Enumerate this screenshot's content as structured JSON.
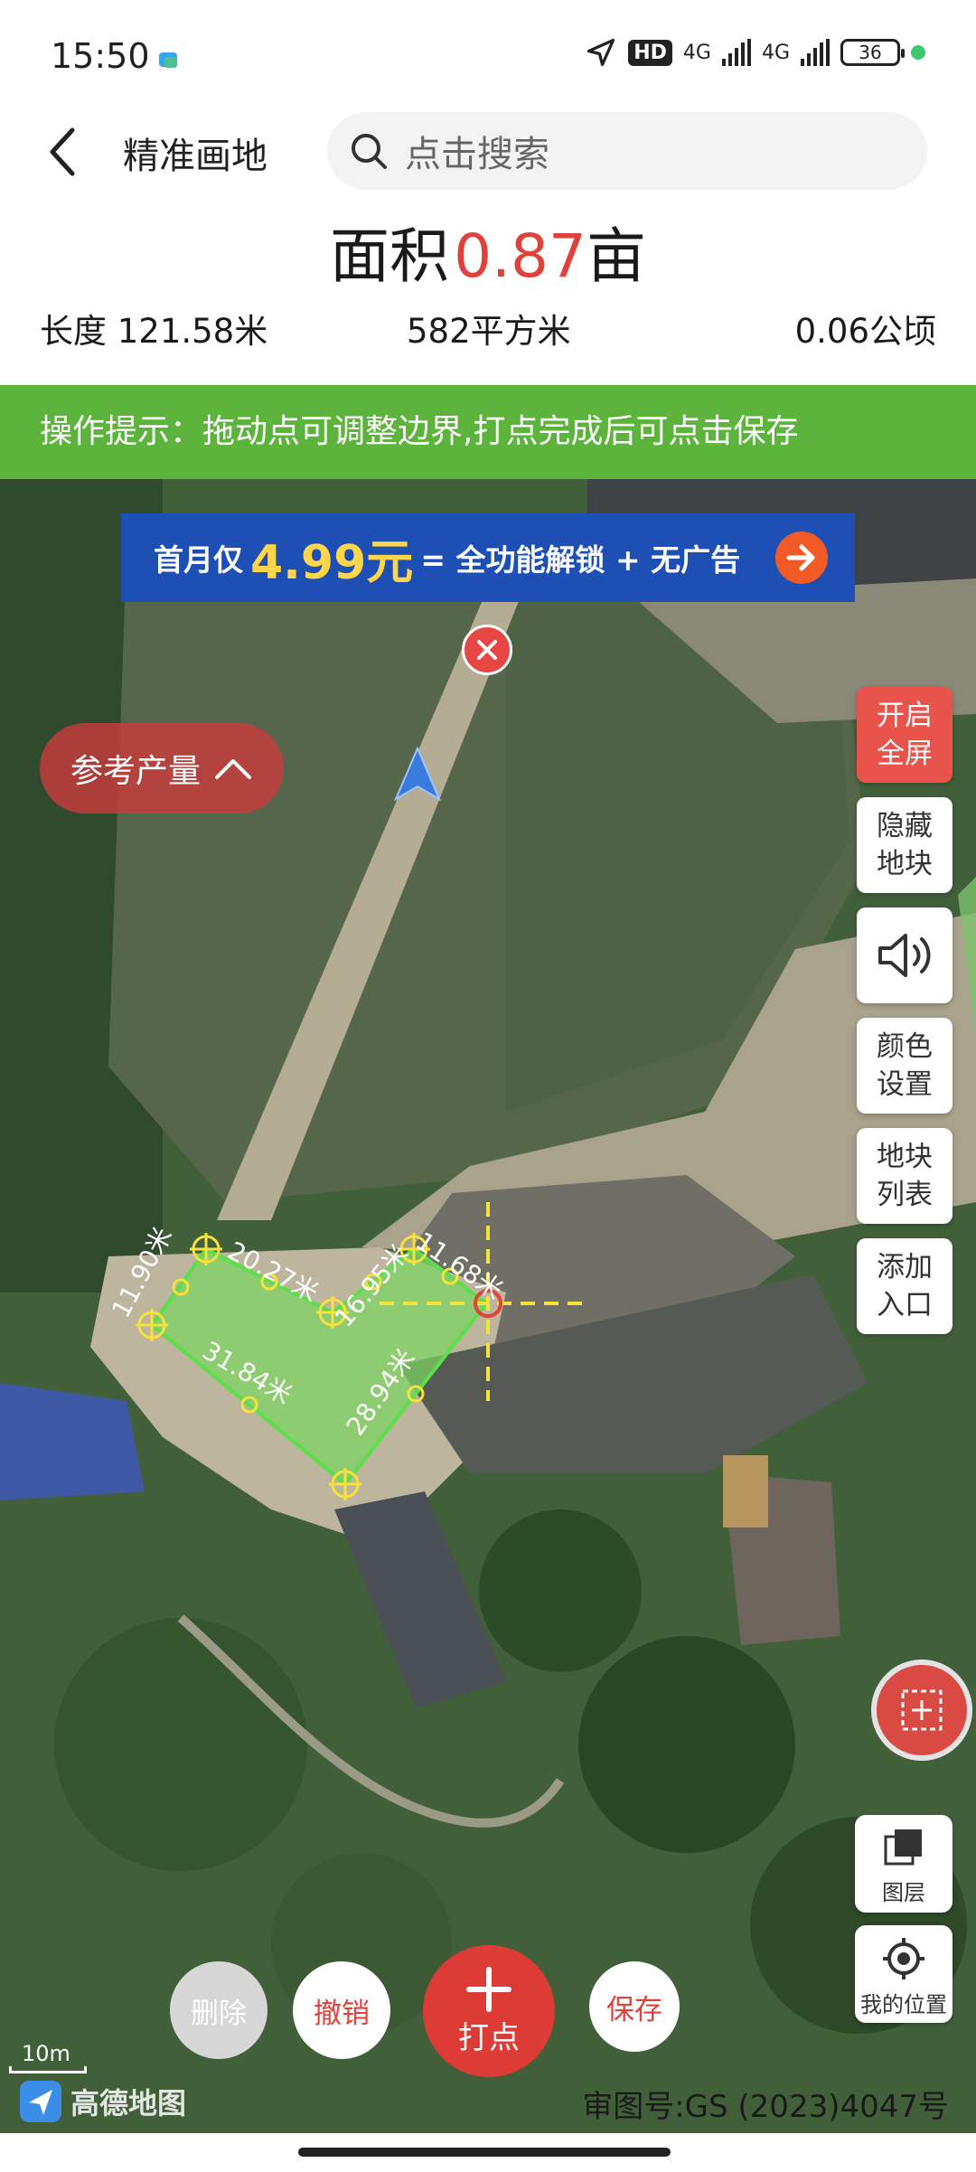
{
  "status_bar": {
    "time": "15:50",
    "network_1": "4G",
    "network_2": "4G",
    "hd_label": "HD",
    "battery": "36"
  },
  "header": {
    "title": "精准画地",
    "search_placeholder": "点击搜索"
  },
  "summary": {
    "area_label": "面积",
    "area_value": "0.87",
    "area_unit": "亩",
    "length": "长度 121.58米",
    "square_meters": "582平方米",
    "hectares": "0.06公顷"
  },
  "tip": "操作提示：拖动点可调整边界,打点完成后可点击保存",
  "map": {
    "promo": {
      "prefix": "首月仅",
      "price": "4.99元",
      "suffix": "= 全功能解锁 + 无广告"
    },
    "yield_button": "参考产量",
    "side_buttons": [
      {
        "line1": "开启",
        "line2": "全屏"
      },
      {
        "line1": "隐藏",
        "line2": "地块"
      },
      {
        "line1": "颜色",
        "line2": "设置"
      },
      {
        "line1": "地块",
        "line2": "列表"
      },
      {
        "line1": "添加",
        "line2": "入口"
      }
    ],
    "layer_label": "图层",
    "location_label": "我的位置",
    "edge_labels": [
      "11.90米",
      "20.27米",
      "16.95米",
      "11.68米",
      "28.94米",
      "31.84米"
    ],
    "scale_label": "10m",
    "brand": "高德地图",
    "approval": "审图号:GS (2023)4047号"
  },
  "actions": {
    "delete": "删除",
    "undo": "撤销",
    "point": "打点",
    "save": "保存"
  },
  "colors": {
    "accent_red": "#e0413a",
    "tip_green": "#5db43c",
    "promo_blue": "#1d4fb4"
  }
}
